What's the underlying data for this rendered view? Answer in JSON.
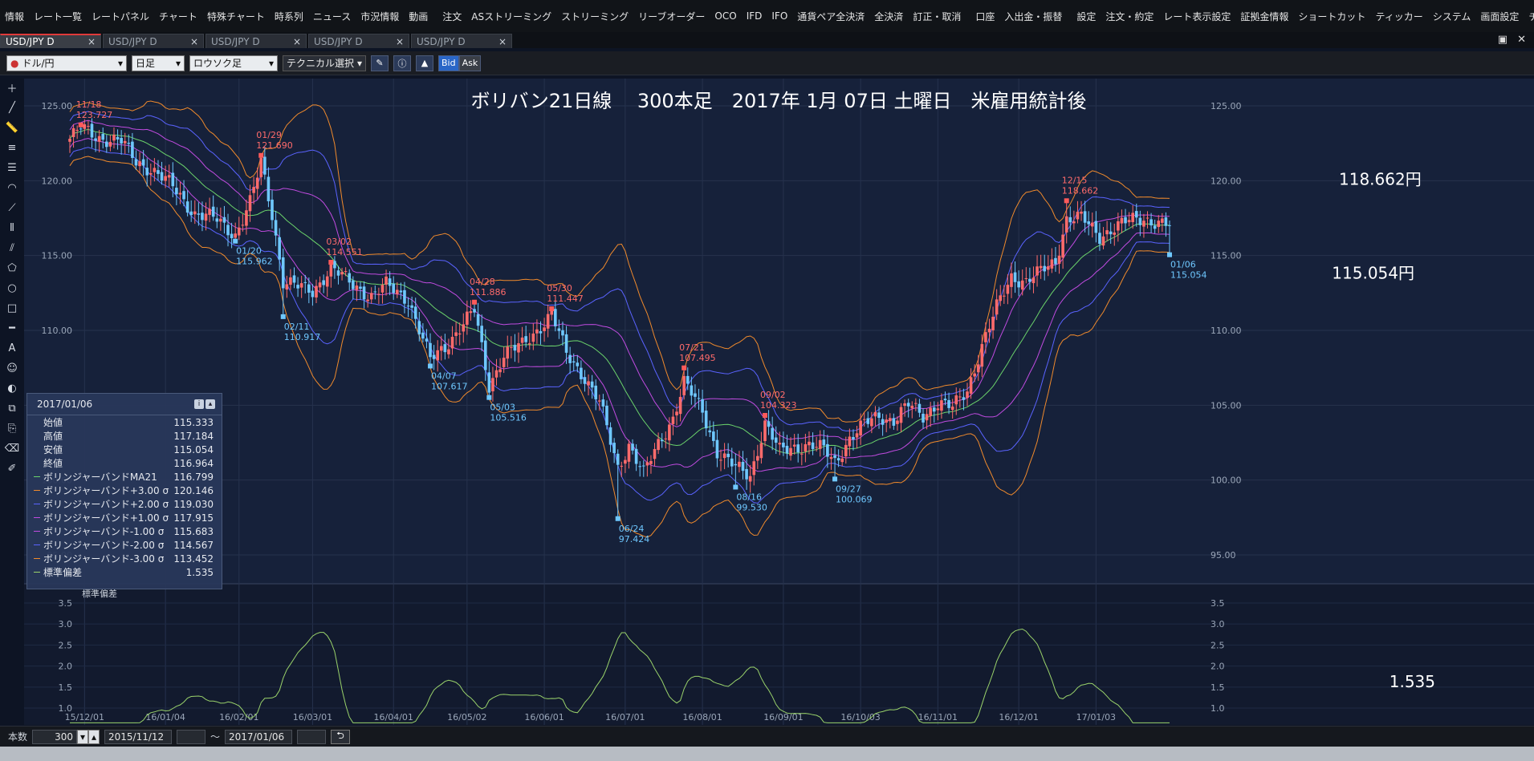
{
  "menubar": {
    "items": [
      {
        "label": "情報"
      },
      {
        "label": "レート一覧"
      },
      {
        "label": "レートパネル"
      },
      {
        "label": "チャート"
      },
      {
        "label": "特殊チャート"
      },
      {
        "label": "時系列"
      },
      {
        "label": "ニュース"
      },
      {
        "label": "市況情報"
      },
      {
        "label": "動画"
      },
      {
        "label": "注文"
      },
      {
        "label": "ASストリーミング"
      },
      {
        "label": "ストリーミング"
      },
      {
        "label": "リーブオーダー"
      },
      {
        "label": "OCO"
      },
      {
        "label": "IFD"
      },
      {
        "label": "IFO"
      },
      {
        "label": "通貨ペア全決済"
      },
      {
        "label": "全決済"
      },
      {
        "label": "訂正・取消"
      },
      {
        "label": "口座"
      },
      {
        "label": "入出金・振替"
      },
      {
        "label": "設定"
      },
      {
        "label": "注文・約定"
      },
      {
        "label": "レート表示設定"
      },
      {
        "label": "証拠金情報"
      },
      {
        "label": "ショートカット"
      },
      {
        "label": "ティッカー"
      },
      {
        "label": "システム"
      },
      {
        "label": "画面設定"
      },
      {
        "label": "チャート"
      }
    ],
    "more_glyph": "▾",
    "close_glyph": "×"
  },
  "tabs": [
    {
      "label": "USD/JPY D",
      "active": true
    },
    {
      "label": "USD/JPY D",
      "active": false
    },
    {
      "label": "USD/JPY D",
      "active": false
    },
    {
      "label": "USD/JPY D",
      "active": false
    },
    {
      "label": "USD/JPY D",
      "active": false
    }
  ],
  "toolbar": {
    "pair": "ドル/円",
    "period": "日足",
    "chart_type": "ロウソク足",
    "technical": "テクニカル選択",
    "bid_label": "Bid",
    "ask_label": "Ask"
  },
  "infobox": {
    "date": "2017/01/06",
    "rows": [
      {
        "label": "始値",
        "value": "115.333",
        "color": ""
      },
      {
        "label": "高値",
        "value": "117.184",
        "color": ""
      },
      {
        "label": "安値",
        "value": "115.054",
        "color": ""
      },
      {
        "label": "終値",
        "value": "116.964",
        "color": ""
      },
      {
        "label": "ボリンジャーバンドMA21",
        "value": "116.799",
        "color": "#6bd36b"
      },
      {
        "label": "ボリンジャーバンド+3.00 σ",
        "value": "120.146",
        "color": "#f08a2c"
      },
      {
        "label": "ボリンジャーバンド+2.00 σ",
        "value": "119.030",
        "color": "#5a63ff"
      },
      {
        "label": "ボリンジャーバンド+1.00 σ",
        "value": "117.915",
        "color": "#c04be0"
      },
      {
        "label": "ボリンジャーバンド-1.00 σ",
        "value": "115.683",
        "color": "#c04be0"
      },
      {
        "label": "ボリンジャーバンド-2.00 σ",
        "value": "114.567",
        "color": "#5a63ff"
      },
      {
        "label": "ボリンジャーバンド-3.00 σ",
        "value": "113.452",
        "color": "#f08a2c"
      },
      {
        "label": "標準偏差",
        "value": "1.535",
        "color": "#9ad36b"
      }
    ]
  },
  "bottombar": {
    "count_label": "本数",
    "count_value": "300",
    "from_date": "2015/11/12",
    "tilde": "〜",
    "to_date": "2017/01/06",
    "reset_glyph": "⮌"
  },
  "chart_data": {
    "type": "candlestick",
    "title": "ボリバン21日線　 300本足　2017年 1月 07日 土曜日　米雇用統計後",
    "price_axis": {
      "ylim": [
        93.5,
        126.5
      ],
      "ticks": [
        125.0,
        120.0,
        115.0,
        110.0,
        105.0,
        100.0,
        95.0
      ],
      "tick_labels": [
        "125.00",
        "120.00",
        "115.00",
        "110.00",
        "105.00",
        "100.00",
        "95.00"
      ]
    },
    "date_axis": {
      "labels": [
        "15/12/01",
        "16/01/04",
        "16/02/01",
        "16/03/01",
        "16/04/01",
        "16/05/02",
        "16/06/01",
        "16/07/01",
        "16/08/01",
        "16/09/01",
        "16/10/03",
        "16/11/01",
        "16/12/01",
        "17/01/03"
      ],
      "positions": [
        4,
        26,
        46,
        66,
        88,
        108,
        129,
        151,
        172,
        194,
        215,
        236,
        258,
        279
      ]
    },
    "highs": [
      {
        "i": 3,
        "date": "11/18",
        "value": "123.727"
      },
      {
        "i": 52,
        "date": "01/29",
        "value": "121.690"
      },
      {
        "i": 71,
        "date": "03/02",
        "value": "114.551"
      },
      {
        "i": 110,
        "date": "04/28",
        "value": "111.886"
      },
      {
        "i": 131,
        "date": "05/30",
        "value": "111.447"
      },
      {
        "i": 167,
        "date": "07/21",
        "value": "107.495"
      },
      {
        "i": 189,
        "date": "09/02",
        "value": "104.323"
      },
      {
        "i": 271,
        "date": "12/15",
        "value": "118.662"
      }
    ],
    "lows": [
      {
        "i": 45,
        "date": "01/20",
        "value": "115.962"
      },
      {
        "i": 58,
        "date": "02/11",
        "value": "110.917"
      },
      {
        "i": 98,
        "date": "04/07",
        "value": "107.617"
      },
      {
        "i": 114,
        "date": "05/03",
        "value": "105.516"
      },
      {
        "i": 149,
        "date": "06/24",
        "value": "97.424"
      },
      {
        "i": 181,
        "date": "08/16",
        "value": "99.530"
      },
      {
        "i": 208,
        "date": "09/27",
        "value": "100.069"
      },
      {
        "i": 299,
        "date": "01/06",
        "value": "115.054"
      }
    ],
    "annotations": [
      {
        "text": "118.662円",
        "date": "12/15",
        "value": 118.662
      },
      {
        "text": "115.054円",
        "date": "01/06",
        "value": 115.054
      },
      {
        "text": "1.535",
        "panel": "stddev",
        "value": 1.535
      }
    ],
    "stddev_panel": {
      "label": "標準偏差",
      "ylim": [
        0.6,
        3.9
      ],
      "ticks": [
        3.5,
        3.0,
        2.5,
        2.0,
        1.5,
        1.0
      ],
      "tick_labels": [
        "3.5",
        "3.0",
        "2.5",
        "2.0",
        "1.5",
        "1.0"
      ],
      "last_value": "1.535"
    },
    "close_keypoints": [
      [
        0,
        122.8
      ],
      [
        3,
        123.5
      ],
      [
        8,
        122.9
      ],
      [
        14,
        122.6
      ],
      [
        18,
        121.3
      ],
      [
        22,
        120.8
      ],
      [
        28,
        119.6
      ],
      [
        34,
        117.8
      ],
      [
        40,
        117.4
      ],
      [
        45,
        116.4
      ],
      [
        49,
        118.5
      ],
      [
        52,
        121.2
      ],
      [
        55,
        117.8
      ],
      [
        58,
        113.3
      ],
      [
        62,
        112.9
      ],
      [
        66,
        112.6
      ],
      [
        71,
        114.2
      ],
      [
        76,
        113.2
      ],
      [
        82,
        112.3
      ],
      [
        86,
        113.0
      ],
      [
        92,
        112.1
      ],
      [
        98,
        108.0
      ],
      [
        102,
        108.9
      ],
      [
        106,
        110.2
      ],
      [
        110,
        111.3
      ],
      [
        114,
        106.3
      ],
      [
        118,
        108.4
      ],
      [
        123,
        109.0
      ],
      [
        128,
        110.3
      ],
      [
        131,
        111.1
      ],
      [
        135,
        108.4
      ],
      [
        140,
        106.9
      ],
      [
        144,
        105.2
      ],
      [
        149,
        100.8
      ],
      [
        152,
        102.4
      ],
      [
        156,
        100.4
      ],
      [
        160,
        102.4
      ],
      [
        164,
        104.2
      ],
      [
        167,
        106.5
      ],
      [
        172,
        104.6
      ],
      [
        176,
        101.9
      ],
      [
        181,
        100.8
      ],
      [
        185,
        100.3
      ],
      [
        189,
        103.8
      ],
      [
        193,
        101.9
      ],
      [
        197,
        102.2
      ],
      [
        201,
        102.4
      ],
      [
        205,
        102.0
      ],
      [
        208,
        101.2
      ],
      [
        212,
        102.8
      ],
      [
        216,
        103.7
      ],
      [
        220,
        104.3
      ],
      [
        224,
        104.0
      ],
      [
        228,
        105.0
      ],
      [
        232,
        104.3
      ],
      [
        236,
        105.2
      ],
      [
        240,
        104.8
      ],
      [
        244,
        106.0
      ],
      [
        248,
        109.0
      ],
      [
        252,
        111.5
      ],
      [
        256,
        113.6
      ],
      [
        260,
        113.3
      ],
      [
        264,
        113.9
      ],
      [
        268,
        114.6
      ],
      [
        271,
        117.5
      ],
      [
        275,
        117.5
      ],
      [
        280,
        116.3
      ],
      [
        284,
        116.9
      ],
      [
        288,
        117.3
      ],
      [
        292,
        117.5
      ],
      [
        296,
        117.2
      ],
      [
        299,
        116.96
      ]
    ]
  }
}
